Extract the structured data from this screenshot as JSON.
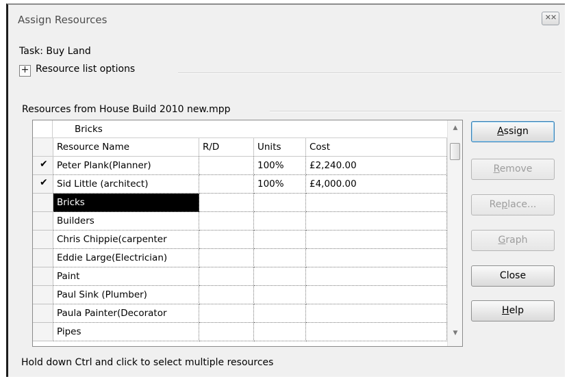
{
  "window": {
    "title": "Assign Resources",
    "close_label": "✕✕"
  },
  "task": {
    "text": "Task: Buy Land"
  },
  "options": {
    "label": "Resource list options",
    "expander_symbol": "+"
  },
  "resources": {
    "label": "Resources from House Build 2010 new.mpp"
  },
  "table": {
    "edit_value": "Bricks",
    "columns": [
      {
        "key": "name",
        "label": "Resource Name"
      },
      {
        "key": "rd",
        "label": "R/D"
      },
      {
        "key": "units",
        "label": "Units"
      },
      {
        "key": "cost",
        "label": "Cost"
      }
    ],
    "rows": [
      {
        "check": "✔",
        "name": "Peter Plank(Planner)",
        "rd": "",
        "units": "100%",
        "cost": "£2,240.00"
      },
      {
        "check": "✔",
        "name": "Sid Little (architect)",
        "rd": "",
        "units": "100%",
        "cost": "£4,000.00"
      },
      {
        "check": "",
        "name": "Bricks",
        "rd": "",
        "units": "",
        "cost": "",
        "selected": true
      },
      {
        "check": "",
        "name": "Builders",
        "rd": "",
        "units": "",
        "cost": ""
      },
      {
        "check": "",
        "name": "Chris Chippie(carpenter",
        "rd": "",
        "units": "",
        "cost": ""
      },
      {
        "check": "",
        "name": "Eddie Large(Electrician)",
        "rd": "",
        "units": "",
        "cost": ""
      },
      {
        "check": "",
        "name": "Paint",
        "rd": "",
        "units": "",
        "cost": ""
      },
      {
        "check": "",
        "name": "Paul Sink (Plumber)",
        "rd": "",
        "units": "",
        "cost": ""
      },
      {
        "check": "",
        "name": "Paula Painter(Decorator",
        "rd": "",
        "units": "",
        "cost": ""
      },
      {
        "check": "",
        "name": "Pipes",
        "rd": "",
        "units": "",
        "cost": ""
      }
    ],
    "scroll_up": "▲",
    "scroll_down": "▼"
  },
  "buttons": {
    "assign": {
      "pre": "",
      "key": "A",
      "post": "ssign"
    },
    "remove": {
      "pre": "",
      "key": "R",
      "post": "emove"
    },
    "replace": {
      "pre": "Re",
      "key": "p",
      "post": "lace..."
    },
    "graph": {
      "pre": "",
      "key": "G",
      "post": "raph"
    },
    "close": {
      "label": "Close"
    },
    "help": {
      "pre": "",
      "key": "H",
      "post": "elp"
    }
  },
  "hint": {
    "text": "Hold down Ctrl and click to select multiple resources"
  },
  "colors": {
    "selection": "#000000",
    "default_border": "#3c7fb1",
    "disabled_text": "#9d9d9d"
  }
}
